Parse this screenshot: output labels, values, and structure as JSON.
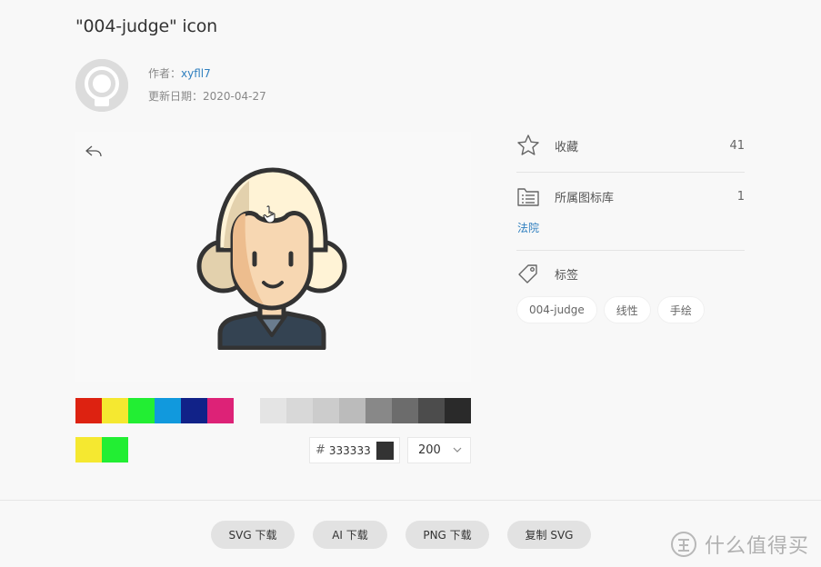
{
  "page": {
    "title": "\"004-judge\" icon"
  },
  "meta": {
    "author_label": "作者：",
    "author_name": "xyfll7",
    "date_label": "更新日期：",
    "date": "2020-04-27"
  },
  "palette": {
    "primary": [
      "#dd2211",
      "#f5e830",
      "#22ee33",
      "#1199dd",
      "#112288",
      "#dd2277"
    ],
    "grays": [
      "#e4e4e4",
      "#d8d8d8",
      "#cccccc",
      "#bbbbbb",
      "#888888",
      "#6c6c6c",
      "#4c4c4c",
      "#2a2a2a"
    ],
    "selected": [
      "#f5e830",
      "#22ee33"
    ]
  },
  "color_input": {
    "hash": "#",
    "value": "333333",
    "swatch": "#333333"
  },
  "size_select": {
    "value": "200"
  },
  "sidebar": {
    "favorites": {
      "label": "收藏",
      "count": "41"
    },
    "library": {
      "label": "所属图标库",
      "count": "1",
      "link": "法院"
    },
    "tags": {
      "label": "标签",
      "items": [
        "004-judge",
        "线性",
        "手绘"
      ]
    }
  },
  "actions": {
    "svg_download": "SVG 下载",
    "ai_download": "AI 下载",
    "png_download": "PNG 下载",
    "copy_svg": "复制 SVG"
  },
  "watermark": {
    "text": "什么值得买",
    "icon": "zhi-logo-icon"
  }
}
